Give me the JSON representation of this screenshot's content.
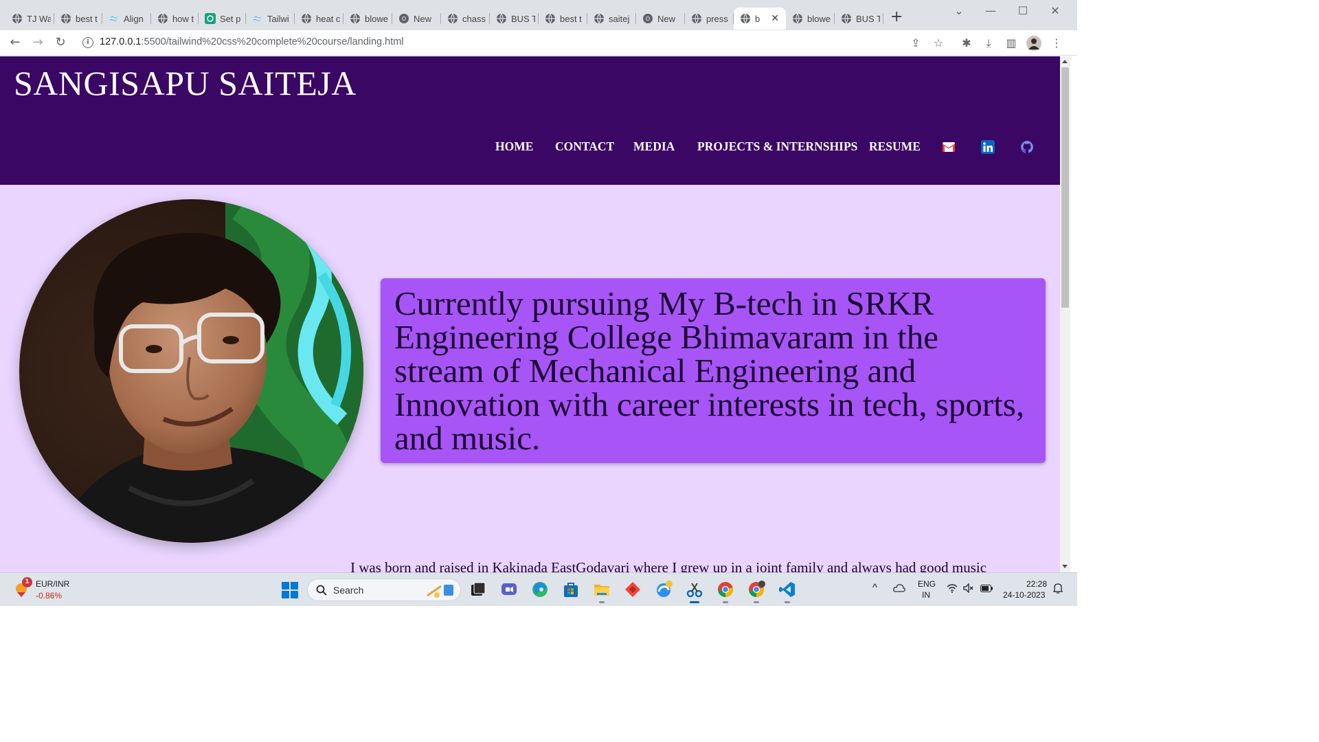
{
  "browser": {
    "tabs": [
      {
        "title": "TJ Wa",
        "icon": "globe-icon"
      },
      {
        "title": "best t",
        "icon": "globe-icon"
      },
      {
        "title": "Align",
        "icon": "tailwind-icon"
      },
      {
        "title": "how t",
        "icon": "globe-icon"
      },
      {
        "title": "Set p",
        "icon": "chatgpt-icon"
      },
      {
        "title": "Tailwi",
        "icon": "tailwind-icon"
      },
      {
        "title": "heat c",
        "icon": "globe-icon"
      },
      {
        "title": "blowe",
        "icon": "globe-icon"
      },
      {
        "title": "New",
        "icon": "chrome-icon"
      },
      {
        "title": "chass",
        "icon": "globe-icon"
      },
      {
        "title": "BUS T",
        "icon": "globe-icon"
      },
      {
        "title": "best t",
        "icon": "globe-icon"
      },
      {
        "title": "saitej",
        "icon": "globe-icon"
      },
      {
        "title": "New",
        "icon": "chrome-icon"
      },
      {
        "title": "press",
        "icon": "globe-icon"
      },
      {
        "title": "b",
        "icon": "globe-icon",
        "active": true
      },
      {
        "title": "blowe",
        "icon": "globe-icon"
      },
      {
        "title": "BUS T",
        "icon": "globe-icon"
      }
    ],
    "url_host": "127.0.0.1",
    "url_path": ":5500/tailwind%20css%20complete%20course/landing.html"
  },
  "header": {
    "title": "SANGISAPU SAITEJA",
    "nav": [
      "HOME",
      "CONTACT",
      "MEDIA",
      "PROJECTS & INTERNSHIPS",
      "RESUME"
    ],
    "social_icons": [
      "gmail-icon",
      "linkedin-icon",
      "github-icon"
    ],
    "bg_color": "#3b0764"
  },
  "hero": {
    "intro": "Currently pursuing My B-tech in SRKR Engineering College Bhimavaram in the stream of Mechanical Engineering and Innovation with career interests in tech, sports, and music.",
    "about": "I was born and raised in Kakinada EastGodavari where I grew up in a joint family and always had good music",
    "page_bg": "#e9d5ff",
    "box_color": "#a855f7"
  },
  "taskbar": {
    "widget_badge": "1",
    "widget_title": "EUR/INR",
    "widget_value": "-0.86%",
    "search_label": "Search",
    "lang_1": "ENG",
    "lang_2": "IN",
    "time": "22:28",
    "date": "24-10-2023"
  }
}
